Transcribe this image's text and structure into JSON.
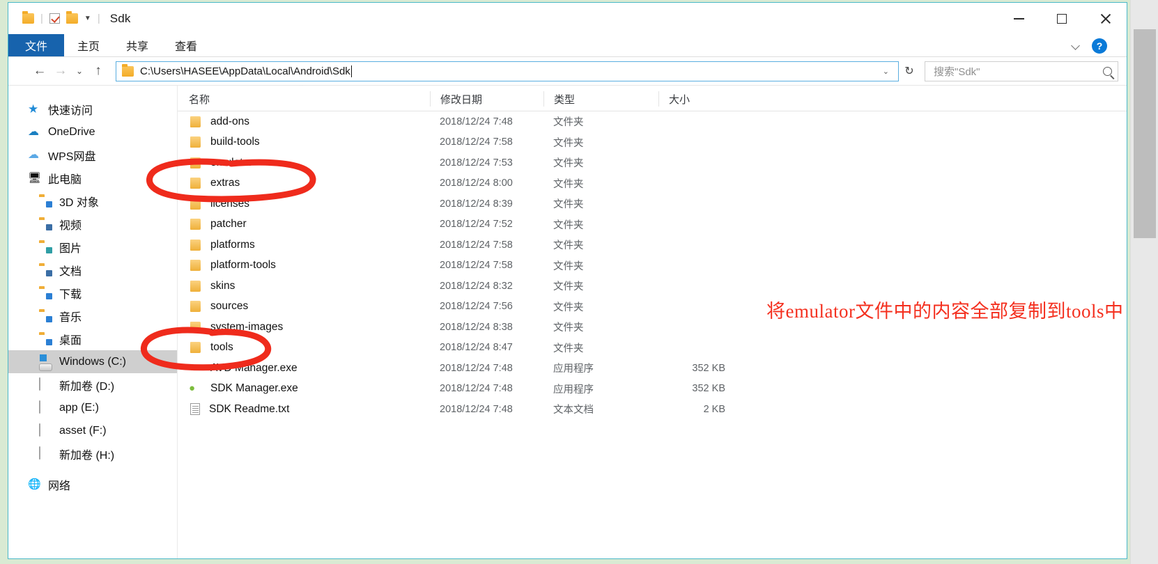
{
  "window": {
    "title": "Sdk",
    "quick_access_icons": [
      "folder-icon",
      "checkbox-icon",
      "folder-icon",
      "dropdown-caret-icon"
    ],
    "controls": {
      "minimize": "—",
      "maximize": "□",
      "close": "✕"
    }
  },
  "ribbon": {
    "tabs": [
      {
        "label": "文件",
        "active": true
      },
      {
        "label": "主页",
        "active": false
      },
      {
        "label": "共享",
        "active": false
      },
      {
        "label": "查看",
        "active": false
      }
    ],
    "collapse_icon": "chevron-down-icon",
    "help_label": "?"
  },
  "navbar": {
    "back": "←",
    "forward": "→",
    "recent": "⌄",
    "up": "↑",
    "path": "C:\\Users\\HASEE\\AppData\\Local\\Android\\Sdk",
    "path_dropdown": "⌄",
    "refresh": "↻",
    "search_placeholder": "搜索\"Sdk\""
  },
  "sidebar": {
    "items": [
      {
        "label": "快速访问",
        "icon": "star-icon",
        "indent": false,
        "selected": false
      },
      {
        "label": "OneDrive",
        "icon": "onedrive-cloud-icon",
        "indent": false,
        "selected": false
      },
      {
        "label": "WPS网盘",
        "icon": "wps-cloud-icon",
        "indent": false,
        "selected": false
      },
      {
        "label": "此电脑",
        "icon": "this-pc-icon",
        "indent": false,
        "selected": false
      },
      {
        "label": "3D 对象",
        "icon": "folder-3d-icon",
        "indent": true,
        "selected": false
      },
      {
        "label": "视频",
        "icon": "folder-video-icon",
        "indent": true,
        "selected": false
      },
      {
        "label": "图片",
        "icon": "folder-pictures-icon",
        "indent": true,
        "selected": false
      },
      {
        "label": "文档",
        "icon": "folder-documents-icon",
        "indent": true,
        "selected": false
      },
      {
        "label": "下载",
        "icon": "folder-downloads-icon",
        "indent": true,
        "selected": false
      },
      {
        "label": "音乐",
        "icon": "folder-music-icon",
        "indent": true,
        "selected": false
      },
      {
        "label": "桌面",
        "icon": "folder-desktop-icon",
        "indent": true,
        "selected": false
      },
      {
        "label": "Windows (C:)",
        "icon": "drive-windows-icon",
        "indent": true,
        "selected": true
      },
      {
        "label": "新加卷 (D:)",
        "icon": "drive-icon",
        "indent": true,
        "selected": false
      },
      {
        "label": "app (E:)",
        "icon": "drive-icon",
        "indent": true,
        "selected": false
      },
      {
        "label": "asset (F:)",
        "icon": "drive-icon",
        "indent": true,
        "selected": false
      },
      {
        "label": "新加卷 (H:)",
        "icon": "drive-icon",
        "indent": true,
        "selected": false
      },
      {
        "label": "网络",
        "icon": "network-icon",
        "indent": false,
        "selected": false
      }
    ]
  },
  "filelist": {
    "columns": [
      {
        "label": "名称",
        "sorted": "asc",
        "sort_glyph": "⌃"
      },
      {
        "label": "修改日期",
        "sorted": ""
      },
      {
        "label": "类型",
        "sorted": ""
      },
      {
        "label": "大小",
        "sorted": ""
      }
    ],
    "rows": [
      {
        "name": "add-ons",
        "date": "2018/12/24 7:48",
        "type": "文件夹",
        "size": "",
        "icon": "folder-icon"
      },
      {
        "name": "build-tools",
        "date": "2018/12/24 7:58",
        "type": "文件夹",
        "size": "",
        "icon": "folder-icon"
      },
      {
        "name": "emulator",
        "date": "2018/12/24 7:53",
        "type": "文件夹",
        "size": "",
        "icon": "folder-icon"
      },
      {
        "name": "extras",
        "date": "2018/12/24 8:00",
        "type": "文件夹",
        "size": "",
        "icon": "folder-icon"
      },
      {
        "name": "licenses",
        "date": "2018/12/24 8:39",
        "type": "文件夹",
        "size": "",
        "icon": "folder-icon"
      },
      {
        "name": "patcher",
        "date": "2018/12/24 7:52",
        "type": "文件夹",
        "size": "",
        "icon": "folder-icon"
      },
      {
        "name": "platforms",
        "date": "2018/12/24 7:58",
        "type": "文件夹",
        "size": "",
        "icon": "folder-icon"
      },
      {
        "name": "platform-tools",
        "date": "2018/12/24 7:58",
        "type": "文件夹",
        "size": "",
        "icon": "folder-icon"
      },
      {
        "name": "skins",
        "date": "2018/12/24 8:32",
        "type": "文件夹",
        "size": "",
        "icon": "folder-icon"
      },
      {
        "name": "sources",
        "date": "2018/12/24 7:56",
        "type": "文件夹",
        "size": "",
        "icon": "folder-icon"
      },
      {
        "name": "system-images",
        "date": "2018/12/24 8:38",
        "type": "文件夹",
        "size": "",
        "icon": "folder-icon"
      },
      {
        "name": "tools",
        "date": "2018/12/24 8:47",
        "type": "文件夹",
        "size": "",
        "icon": "folder-icon"
      },
      {
        "name": "AVD Manager.exe",
        "date": "2018/12/24 7:48",
        "type": "应用程序",
        "size": "352 KB",
        "icon": "android-icon"
      },
      {
        "name": "SDK Manager.exe",
        "date": "2018/12/24 7:48",
        "type": "应用程序",
        "size": "352 KB",
        "icon": "android-icon"
      },
      {
        "name": "SDK Readme.txt",
        "date": "2018/12/24 7:48",
        "type": "文本文档",
        "size": "2 KB",
        "icon": "text-file-icon"
      }
    ]
  },
  "annotations": {
    "note": "将emulator文件中的内容全部复制到tools中",
    "color": "#f4301f",
    "circles": [
      "emulator-row-circle",
      "tools-row-circle"
    ]
  },
  "colors": {
    "accent": "#1763ad",
    "window_border": "#4ab8c8",
    "desktop": "#d9ead3",
    "selection": "#cfcfcf",
    "annotation": "#f4301f",
    "help_badge": "#0a7ad8"
  }
}
